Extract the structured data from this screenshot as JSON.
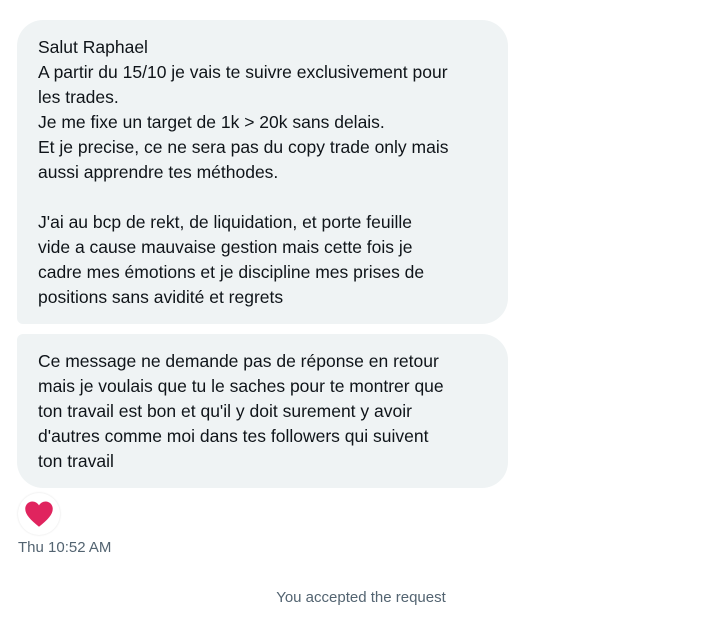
{
  "messages": [
    {
      "lines": [
        "Salut Raphael",
        "A partir du 15/10 je vais te suivre exclusivement pour",
        "les trades.",
        "Je me fixe un target de 1k > 20k sans delais.",
        "Et je precise, ce ne sera pas du copy trade only mais",
        "aussi apprendre tes méthodes.",
        "",
        "J'ai au bcp de rekt, de liquidation, et porte feuille",
        "vide a cause mauvaise gestion mais cette fois je",
        "cadre mes émotions et je discipline mes prises de",
        "positions sans avidité et regrets"
      ]
    },
    {
      "lines": [
        "Ce message ne demande pas de réponse en retour",
        "mais je voulais que tu le saches pour te montrer que",
        "ton travail est bon et qu'il y doit surement y avoir",
        "d'autres comme moi dans tes followers qui suivent",
        "ton travail"
      ]
    }
  ],
  "reaction": {
    "icon": "heart-icon",
    "color": "#e0245e"
  },
  "timestamp": "Thu 10:52 AM",
  "system_note": "You accepted the request"
}
